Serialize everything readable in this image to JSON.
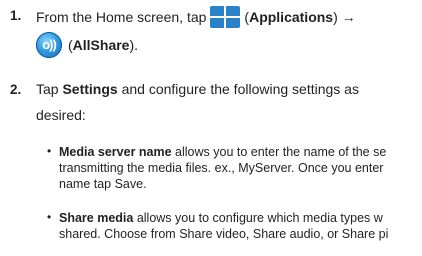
{
  "steps": [
    {
      "number": "1.",
      "line1_pre": "From the Home screen, tap",
      "apps_label": "Applications",
      "arrow": "→",
      "allshare_label": "AllShare",
      "icon_apps": "applications-grid-icon",
      "icon_share": "allshare-icon"
    },
    {
      "number": "2.",
      "pre": "Tap ",
      "bold": "Settings",
      "post": " and configure the following settings as",
      "line2": "desired:"
    }
  ],
  "bullets": [
    {
      "bold": "Media server name",
      "line1": " allows you to enter the name of the se",
      "line2": "transmitting the media files. ex., MyServer. Once you enter",
      "line3": "name tap Save."
    },
    {
      "bold": "Share media",
      "line1": " allows you to configure which media types w",
      "line2": "shared. Choose from Share video, Share audio, or Share pi"
    }
  ],
  "symbols": {
    "bullet": "•",
    "icon_share_text": "o))"
  }
}
